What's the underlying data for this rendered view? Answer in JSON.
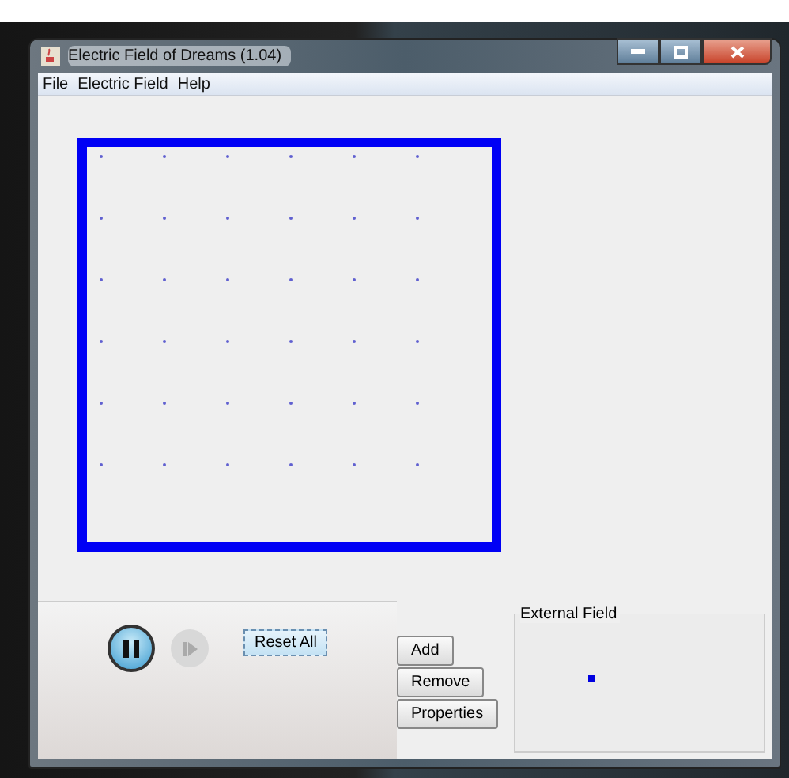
{
  "window": {
    "title": "Electric Field of Dreams (1.04)"
  },
  "menu": [
    "File",
    "Electric Field",
    "Help"
  ],
  "controls": {
    "playing": true,
    "step_disabled": true,
    "reset": "Reset All"
  },
  "buttons": [
    "Add",
    "Remove",
    "Properties"
  ],
  "external_field": {
    "title": "External Field"
  }
}
